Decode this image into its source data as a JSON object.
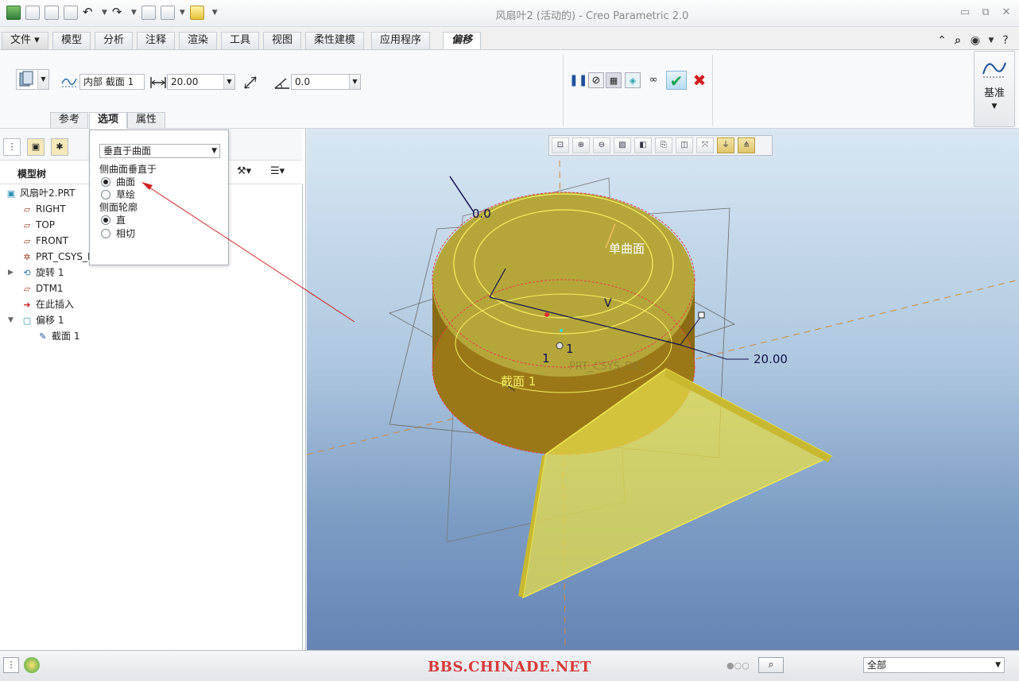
{
  "window": {
    "title": "风扇叶2 (活动的) - Creo Parametric 2.0",
    "minimize": "▭",
    "restore": "⧉",
    "close": "✕"
  },
  "menu": {
    "file": "文件",
    "tabs": [
      "模型",
      "分析",
      "注释",
      "渲染",
      "工具",
      "视图",
      "柔性建模",
      "应用程序"
    ],
    "active_tab": "偏移"
  },
  "ribbon": {
    "section_type": "内部 截面 1",
    "distance_value": "20.00",
    "angle_value": "0.0",
    "datum_label": "基准",
    "subtabs": [
      "参考",
      "选项",
      "属性"
    ],
    "active_subtab": "选项"
  },
  "options_popup": {
    "select_value": "垂直于曲面",
    "group1_label": "侧曲面垂直于",
    "group1_options": [
      {
        "label": "曲面",
        "selected": true
      },
      {
        "label": "草绘",
        "selected": false
      }
    ],
    "group2_label": "侧面轮廓",
    "group2_options": [
      {
        "label": "直",
        "selected": true
      },
      {
        "label": "相切",
        "selected": false
      }
    ]
  },
  "model_tree": {
    "title": "模型树",
    "items": [
      {
        "label": "风扇叶2.PRT",
        "icon": "part-icon"
      },
      {
        "label": "RIGHT",
        "icon": "datum-plane-icon"
      },
      {
        "label": "TOP",
        "icon": "datum-plane-icon"
      },
      {
        "label": "FRONT",
        "icon": "datum-plane-icon"
      },
      {
        "label": "PRT_CSYS_DEF",
        "icon": "csys-icon"
      },
      {
        "label": "旋转 1",
        "icon": "revolve-icon"
      },
      {
        "label": "DTM1",
        "icon": "datum-plane-icon"
      },
      {
        "label": "在此插入",
        "icon": "insert-arrow-icon"
      },
      {
        "label": "偏移 1",
        "icon": "offset-icon"
      },
      {
        "label": "截面 1",
        "icon": "sketch-icon"
      }
    ]
  },
  "viewport": {
    "label_single_surface": "单曲面",
    "label_section": "截面 1",
    "label_dim": "20.00",
    "label_zero": "0.0",
    "label_v": "V",
    "label_one_a": "1",
    "label_one_b": "1",
    "label_csys": "PRT_CSYS_DEF"
  },
  "statusbar": {
    "watermark": "BBS.CHINADE.NET",
    "filter": "全部"
  },
  "colors": {
    "accent_green": "#1aa34a",
    "cancel_red": "#d02020",
    "model_yellow": "#d8d23a",
    "viewport_bottom": "#6684b4"
  }
}
